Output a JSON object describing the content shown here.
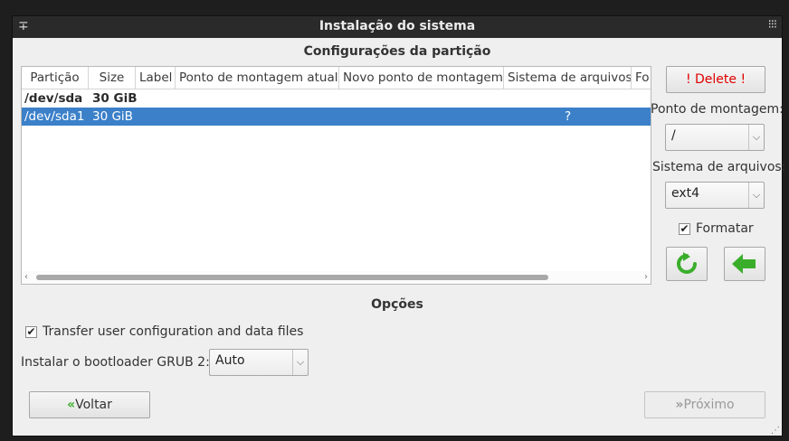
{
  "window": {
    "title": "Instalação do sistema"
  },
  "partition_section": {
    "title": "Configurações da partição",
    "columns": [
      "Partição",
      "Size",
      "Label",
      "Ponto de montagem atual",
      "Novo ponto de montagem",
      "Sistema de arquivos",
      "Fo"
    ],
    "rows": [
      {
        "partition": "/dev/sda",
        "size": "30 GiB",
        "label": "",
        "current_mount": "",
        "new_mount": "",
        "filesystem": ""
      },
      {
        "partition": "/dev/sda1",
        "size": "30 GiB",
        "label": "",
        "current_mount": "",
        "new_mount": "",
        "filesystem": "?"
      }
    ]
  },
  "side_panel": {
    "delete_label": "! Delete !",
    "delete_color": "#e00000",
    "mount_point_label": "Ponto de montagem:",
    "mount_point_value": "/",
    "filesystem_label": "Sistema de arquivos:",
    "filesystem_value": "ext4",
    "format_label": "Formatar",
    "format_checked": true,
    "refresh_icon": "refresh-arrow-icon",
    "apply_icon": "arrow-left-icon",
    "icon_color": "#3aae2b"
  },
  "options_section": {
    "title": "Opções",
    "transfer_label": "Transfer user configuration and data files",
    "transfer_checked": true,
    "bootloader_label": "Instalar o bootloader GRUB 2:",
    "bootloader_value": "Auto"
  },
  "nav": {
    "back_label": "Voltar",
    "next_label": "Próximo"
  }
}
